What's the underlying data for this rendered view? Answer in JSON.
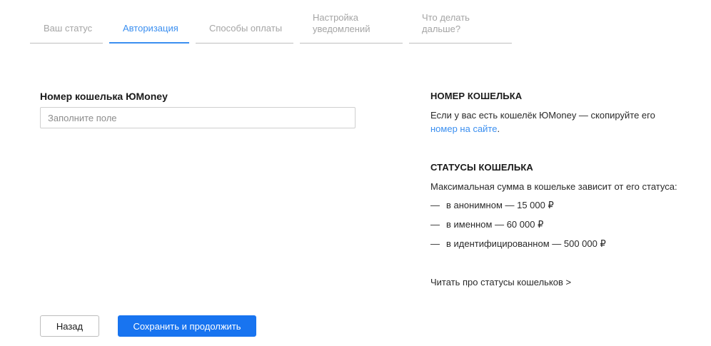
{
  "tabs": [
    {
      "label": "Ваш статус",
      "active": false
    },
    {
      "label": "Авторизация",
      "active": true
    },
    {
      "label": "Способы оплаты",
      "active": false
    },
    {
      "label": "Настройка уведомлений",
      "active": false
    },
    {
      "label": "Что делать дальше?",
      "active": false
    }
  ],
  "form": {
    "wallet_label": "Номер кошелька ЮMoney",
    "wallet_placeholder": "Заполните поле",
    "wallet_value": ""
  },
  "info": {
    "wallet_heading": "НОМЕР КОШЕЛЬКА",
    "wallet_text": "Если у вас есть кошелёк ЮMoney — скопируйте его",
    "wallet_link": "номер на сайте",
    "wallet_link_suffix": ".",
    "statuses_heading": "СТАТУСЫ КОШЕЛЬКА",
    "statuses_text": "Максимальная сумма в кошельке зависит от его статуса:",
    "dash": "—",
    "statuses": [
      "в анонимном — 15 000 ₽",
      "в именном — 60 000 ₽",
      "в идентифицированном — 500 000 ₽"
    ],
    "read_more_link": "Читать про статусы кошельков >"
  },
  "buttons": {
    "back": "Назад",
    "save": "Сохранить и продолжить"
  },
  "colors": {
    "accent": "#3b8ff0",
    "primary_button": "#1874f0",
    "inactive_tab": "#a5a5a5"
  }
}
